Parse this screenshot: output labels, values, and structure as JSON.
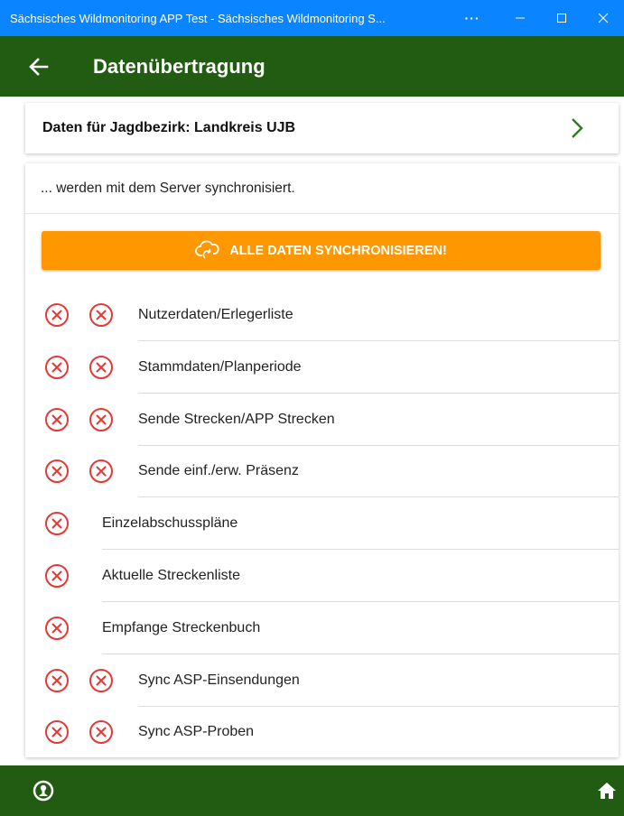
{
  "window": {
    "title": "Sächsisches Wildmonitoring APP Test - Sächsisches Wildmonitoring S...",
    "more": "···"
  },
  "appbar": {
    "title": "Datenübertragung"
  },
  "district": {
    "label": "Daten für Jagdbezirk: Landkreis UJB"
  },
  "sync": {
    "subtitle": "... werden mit dem Server synchronisiert.",
    "button_label": "ALLE DATEN SYNCHRONISIEREN!",
    "items": [
      {
        "label": "Nutzerdaten/Erlegerliste",
        "icons": 2
      },
      {
        "label": "Stammdaten/Planperiode",
        "icons": 2
      },
      {
        "label": "Sende Strecken/APP Strecken",
        "icons": 2
      },
      {
        "label": "Sende einf./erw. Präsenz",
        "icons": 2
      },
      {
        "label": "Einzelabschusspläne",
        "icons": 1
      },
      {
        "label": "Aktuelle Streckenliste",
        "icons": 1
      },
      {
        "label": "Empfange Streckenbuch",
        "icons": 1
      },
      {
        "label": "Sync ASP-Einsendungen",
        "icons": 2
      },
      {
        "label": "Sync ASP-Proben",
        "icons": 2
      }
    ]
  },
  "colors": {
    "titlebar": "#0a84ff",
    "appbar": "#215c12",
    "accent": "#ff9800",
    "error": "#e53935"
  }
}
